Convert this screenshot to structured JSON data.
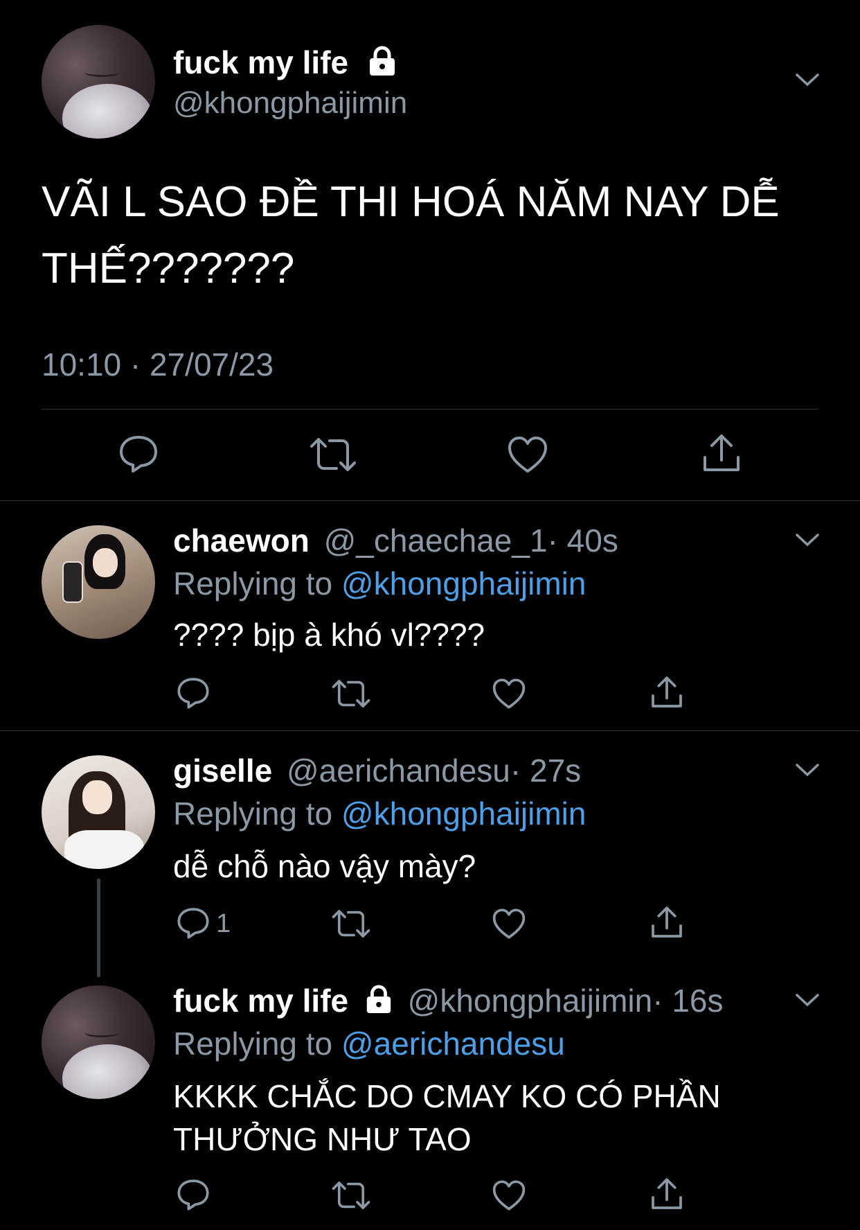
{
  "main_tweet": {
    "display_name": "fuck my life",
    "handle": "@khongphaijimin",
    "text_line1": "VÃI L SAO ĐỀ THI HOÁ NĂM NAY DỄ",
    "text_line2": "THẾ???????",
    "timestamp": "10:10 · 27/07/23",
    "avatar_icon": "sleeping-face-avatar"
  },
  "replies": [
    {
      "display_name": "chaewon",
      "handle": "@_chaechae_1",
      "time": "· 40s",
      "replying_prefix": "Replying to",
      "replying_to": "@khongphaijimin",
      "text": "???? bịp à khó vl????",
      "reply_count": ""
    },
    {
      "display_name": "giselle",
      "handle": "@aerichandesu",
      "time": "· 27s",
      "replying_prefix": "Replying to",
      "replying_to": "@khongphaijimin",
      "text": "dễ chỗ nào vậy mày?",
      "reply_count": "1"
    },
    {
      "display_name": "fuck my life",
      "handle": "@khongphaijimin",
      "time": "· 16s",
      "replying_prefix": "Replying to",
      "replying_to": "@aerichandesu",
      "text_line1": "KKKK CHẮC DO CMAY KO CÓ PHẦN",
      "text_line2": "THƯỞNG NHƯ TAO",
      "reply_count": ""
    }
  ],
  "colors": {
    "background": "#000000",
    "text": "#ffffff",
    "muted": "#8b98a5",
    "link": "#4d9fe8",
    "divider": "#2f3336"
  }
}
